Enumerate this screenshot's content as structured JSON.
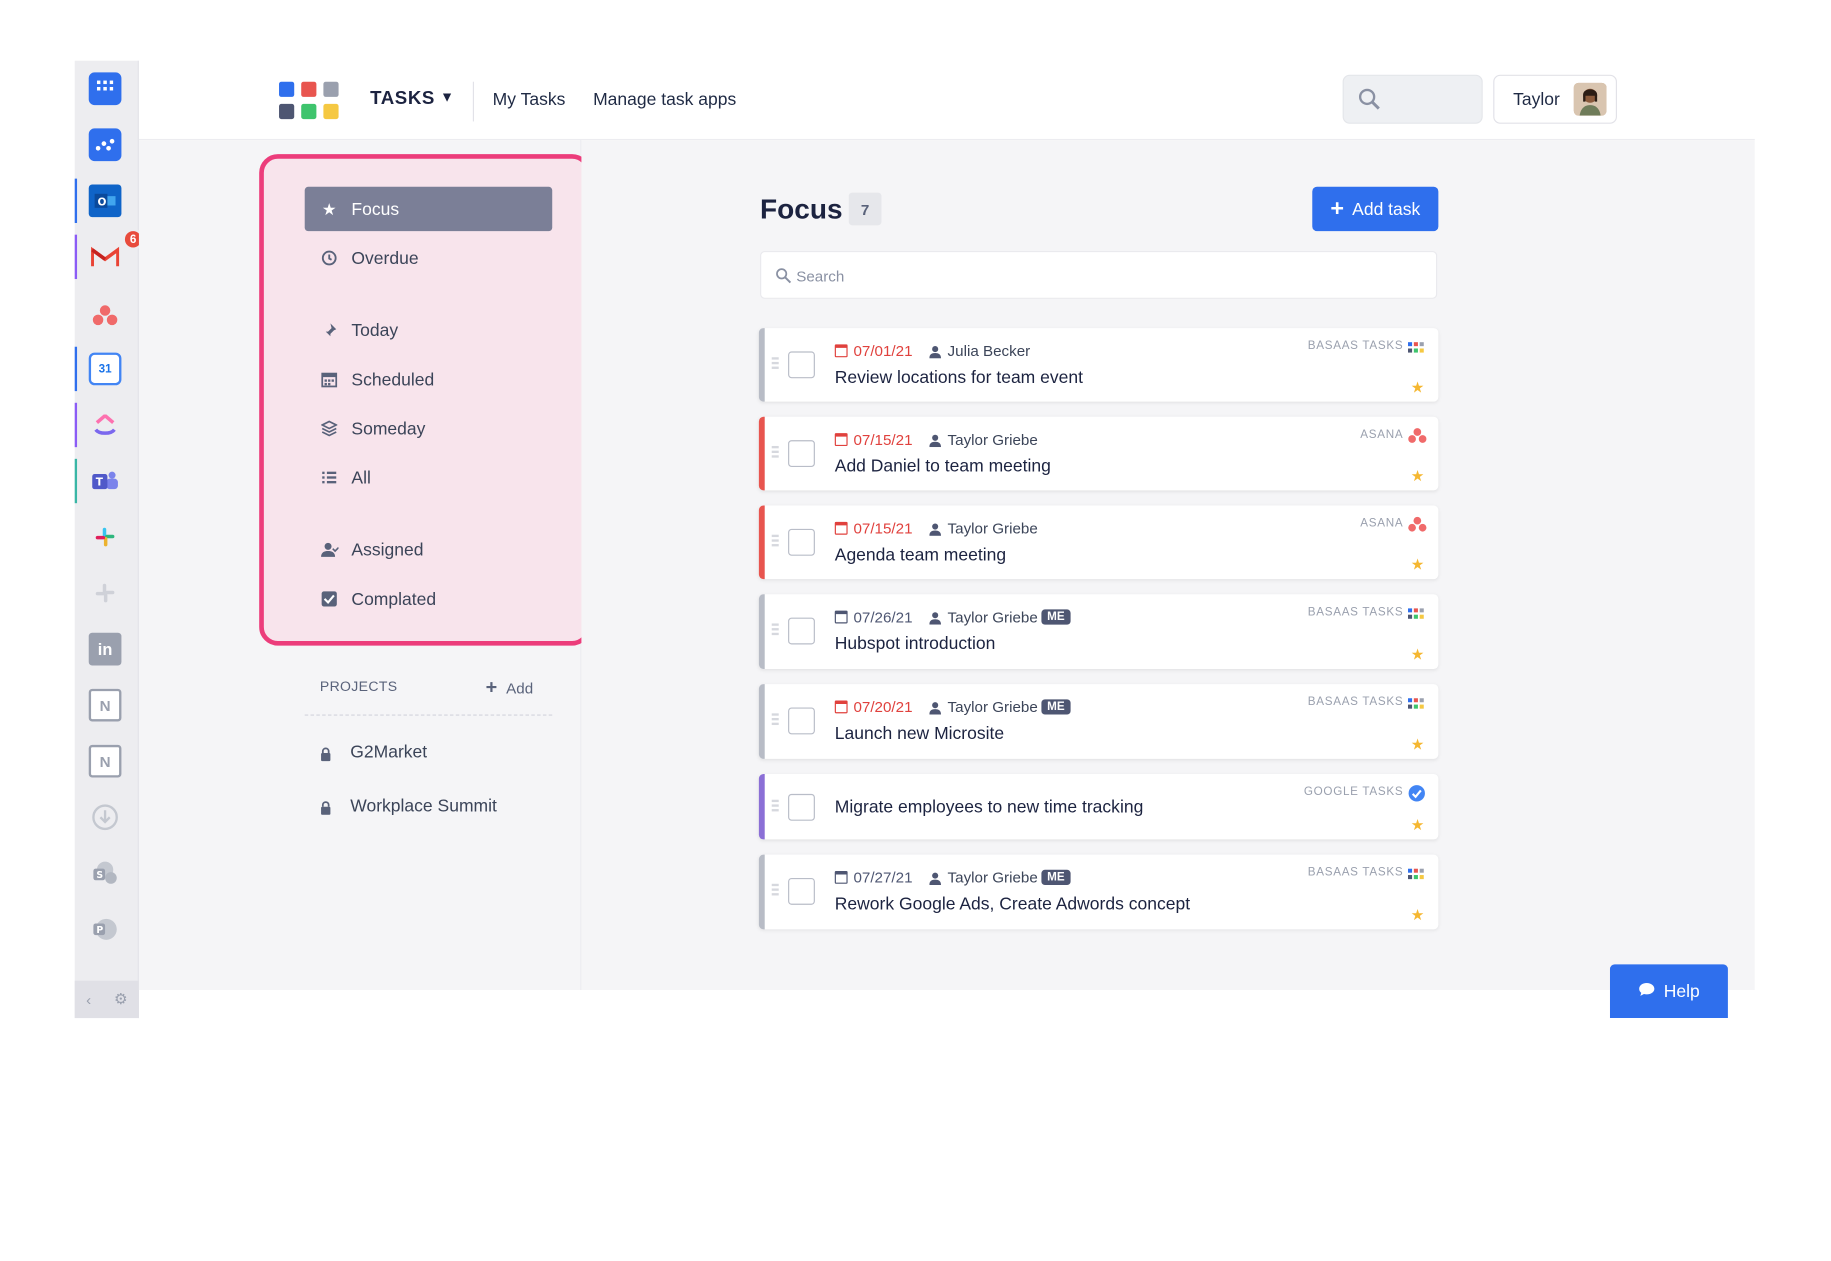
{
  "header": {
    "app_title": "TASKS",
    "nav": [
      "My Tasks",
      "Manage task apps"
    ],
    "user_name": "Taylor"
  },
  "sidebar": {
    "items": [
      {
        "label": "Focus",
        "icon": "star-icon",
        "active": true
      },
      {
        "label": "Overdue",
        "icon": "clock-icon"
      },
      {
        "label": "Today",
        "icon": "pin-icon"
      },
      {
        "label": "Scheduled",
        "icon": "calendar-icon"
      },
      {
        "label": "Someday",
        "icon": "layers-icon"
      },
      {
        "label": "All",
        "icon": "list-icon"
      },
      {
        "label": "Assigned",
        "icon": "user-assign-icon"
      },
      {
        "label": "Complated",
        "icon": "checkbox-icon"
      }
    ],
    "projects_title": "PROJECTS",
    "projects_add": "Add",
    "projects": [
      "G2Market",
      "Workplace Summit"
    ]
  },
  "main": {
    "title": "Focus",
    "count": "7",
    "add_label": "Add task",
    "search_placeholder": "Search",
    "tasks": [
      {
        "date": "07/01/21",
        "date_overdue": true,
        "assignee": "Julia Becker",
        "me": false,
        "title": "Review locations for team event",
        "source": "BASAAS TASKS",
        "accent": "#b8bcc6"
      },
      {
        "date": "07/15/21",
        "date_overdue": true,
        "assignee": "Taylor Griebe",
        "me": false,
        "title": "Add Daniel to team meeting",
        "source": "ASANA",
        "accent": "#e8554f"
      },
      {
        "date": "07/15/21",
        "date_overdue": true,
        "assignee": "Taylor Griebe",
        "me": false,
        "title": "Agenda team meeting",
        "source": "ASANA",
        "accent": "#e8554f"
      },
      {
        "date": "07/26/21",
        "date_overdue": false,
        "assignee": "Taylor Griebe",
        "me": true,
        "me_label": "ME",
        "title": "Hubspot introduction",
        "source": "BASAAS TASKS",
        "accent": "#b8bcc6"
      },
      {
        "date": "07/20/21",
        "date_overdue": true,
        "assignee": "Taylor Griebe",
        "me": true,
        "me_label": "ME",
        "title": "Launch new Microsite",
        "source": "BASAAS TASKS",
        "accent": "#b8bcc6"
      },
      {
        "date": "",
        "assignee": "",
        "me": false,
        "title": "Migrate employees to new time tracking",
        "source": "GOOGLE TASKS",
        "accent": "#8b6fd6"
      },
      {
        "date": "07/27/21",
        "date_overdue": false,
        "assignee": "Taylor Griebe",
        "me": true,
        "me_label": "ME",
        "title": "Rework Google Ads, Create Adwords concept",
        "source": "BASAAS TASKS",
        "accent": "#b8bcc6"
      }
    ]
  },
  "rail": {
    "gmail_badge": "6",
    "icons": [
      "apps-grid-icon",
      "workflow-icon",
      "outlook-icon",
      "gmail-icon",
      "asana-icon",
      "google-calendar-icon",
      "clickup-icon",
      "teams-icon",
      "slack-icon",
      "slack-inactive-icon",
      "linkedin-icon",
      "notion-icon",
      "notion-icon-2",
      "download-icon",
      "sharepoint-icon",
      "powerpoint-icon"
    ]
  },
  "help_label": "Help",
  "colors": {
    "accent": "#2f6fed",
    "highlight_border": "#ec3d7b",
    "overdue": "#e0413d"
  }
}
